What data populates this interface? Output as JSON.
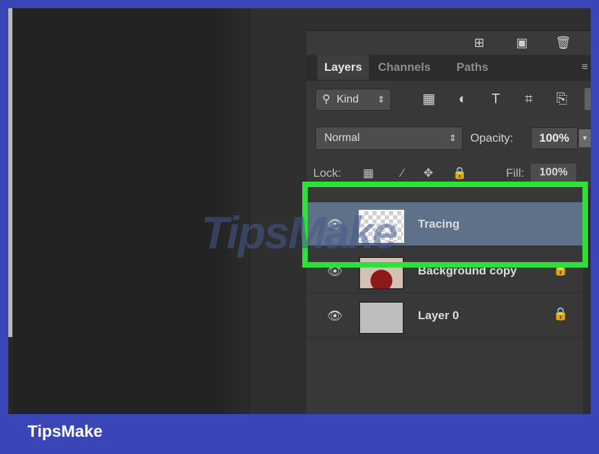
{
  "panel": {
    "icon_bar": [
      {
        "icon": "new-layer-icon",
        "glyph": "⊞"
      },
      {
        "icon": "camera-icon",
        "glyph": "▣"
      },
      {
        "icon": "trash-icon",
        "glyph": "🗑"
      }
    ],
    "tabs": [
      {
        "label": "Layers",
        "active": true
      },
      {
        "label": "Channels",
        "active": false
      },
      {
        "label": "Paths",
        "active": false
      }
    ],
    "tab_menu_glyph": "≡",
    "filter": {
      "kind_label": "Kind",
      "icons": [
        {
          "icon": "pixel-filter-icon",
          "glyph": "▦"
        },
        {
          "icon": "adjustment-filter-icon",
          "glyph": "◐"
        },
        {
          "icon": "type-filter-icon",
          "glyph": "T"
        },
        {
          "icon": "shape-filter-icon",
          "glyph": "⌗"
        },
        {
          "icon": "smart-object-filter-icon",
          "glyph": "⎘"
        }
      ]
    },
    "blend_mode": "Normal",
    "opacity_label": "Opacity:",
    "opacity_value": "100%",
    "lock_label": "Lock:",
    "fill_label": "Fill:",
    "fill_value": "100%"
  },
  "layers": [
    {
      "name": "Tracing",
      "selected": true,
      "thumbnail": "transparent",
      "locked": false,
      "visible": true
    },
    {
      "name": "Background copy",
      "selected": false,
      "thumbnail": "photo",
      "locked": true,
      "visible": true
    },
    {
      "name": "Layer 0",
      "selected": false,
      "thumbnail": "gray",
      "locked": true,
      "visible": true
    }
  ],
  "overlay": {
    "highlight_color": "#2de03a",
    "watermark_text": "TipsMake"
  },
  "footer": {
    "brand": "TipsMake",
    "background": "#3a46b8"
  },
  "colors": {
    "selected_layer": "#5f7089",
    "panel_bg": "#383838",
    "workspace_bg": "#262626"
  }
}
